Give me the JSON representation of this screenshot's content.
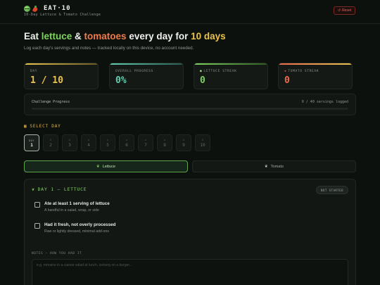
{
  "header": {
    "title": "EAT·10",
    "subtitle": "10-Day Lettuce & Tomato Challenge",
    "reset_label": "Reset"
  },
  "hero": {
    "title_part1": "Eat ",
    "title_lettuce": "lettuce",
    "title_amp": " & ",
    "title_tomatoes": "tomatoes",
    "title_mid": " every day for ",
    "title_days": "10 days",
    "subtitle": "Log each day's servings and notes — tracked locally on this device, no account needed."
  },
  "stats": [
    {
      "label": "DAY",
      "value": "1 / 10",
      "color": "#e8c34e"
    },
    {
      "label": "OVERALL PROGRESS",
      "value": "0%",
      "color": "#5fd0b0"
    },
    {
      "label": "LETTUCE STREAK",
      "value": "0",
      "color": "#7dd35e"
    },
    {
      "label": "TOMATO STREAK",
      "value": "0",
      "color": "#ef6a4a"
    }
  ],
  "progress": {
    "label": "Challenge Progress",
    "count": "0 / 40 servings logged",
    "fraction": 0
  },
  "select_day": {
    "title": "SELECT DAY",
    "active_prefix": "DAY",
    "days": [
      "1",
      "2",
      "3",
      "4",
      "5",
      "6",
      "7",
      "8",
      "9",
      "10"
    ],
    "active_index": 0
  },
  "tabs": {
    "lettuce": "Lettuce",
    "tomato": "Tomato"
  },
  "panel": {
    "title": "DAY 1 — LETTUCE",
    "status": "NOT STARTED",
    "tasks": [
      {
        "title": "Ate at least 1 serving of lettuce",
        "desc": "A handful in a salad, wrap, or side"
      },
      {
        "title": "Had it fresh, not overly processed",
        "desc": "Raw or lightly dressed, minimal add-ons"
      }
    ],
    "notes_label": "NOTES — HOW YOU HAD IT",
    "notes_placeholder": "e.g. romaine in a caesar salad at lunch, iceberg on a burger..."
  },
  "colors": {
    "background": "#0d110e",
    "lettuce": "#7dd35e",
    "tomato": "#ef7a4a",
    "highlight": "#e8c34e",
    "reset": "#e0685a"
  }
}
